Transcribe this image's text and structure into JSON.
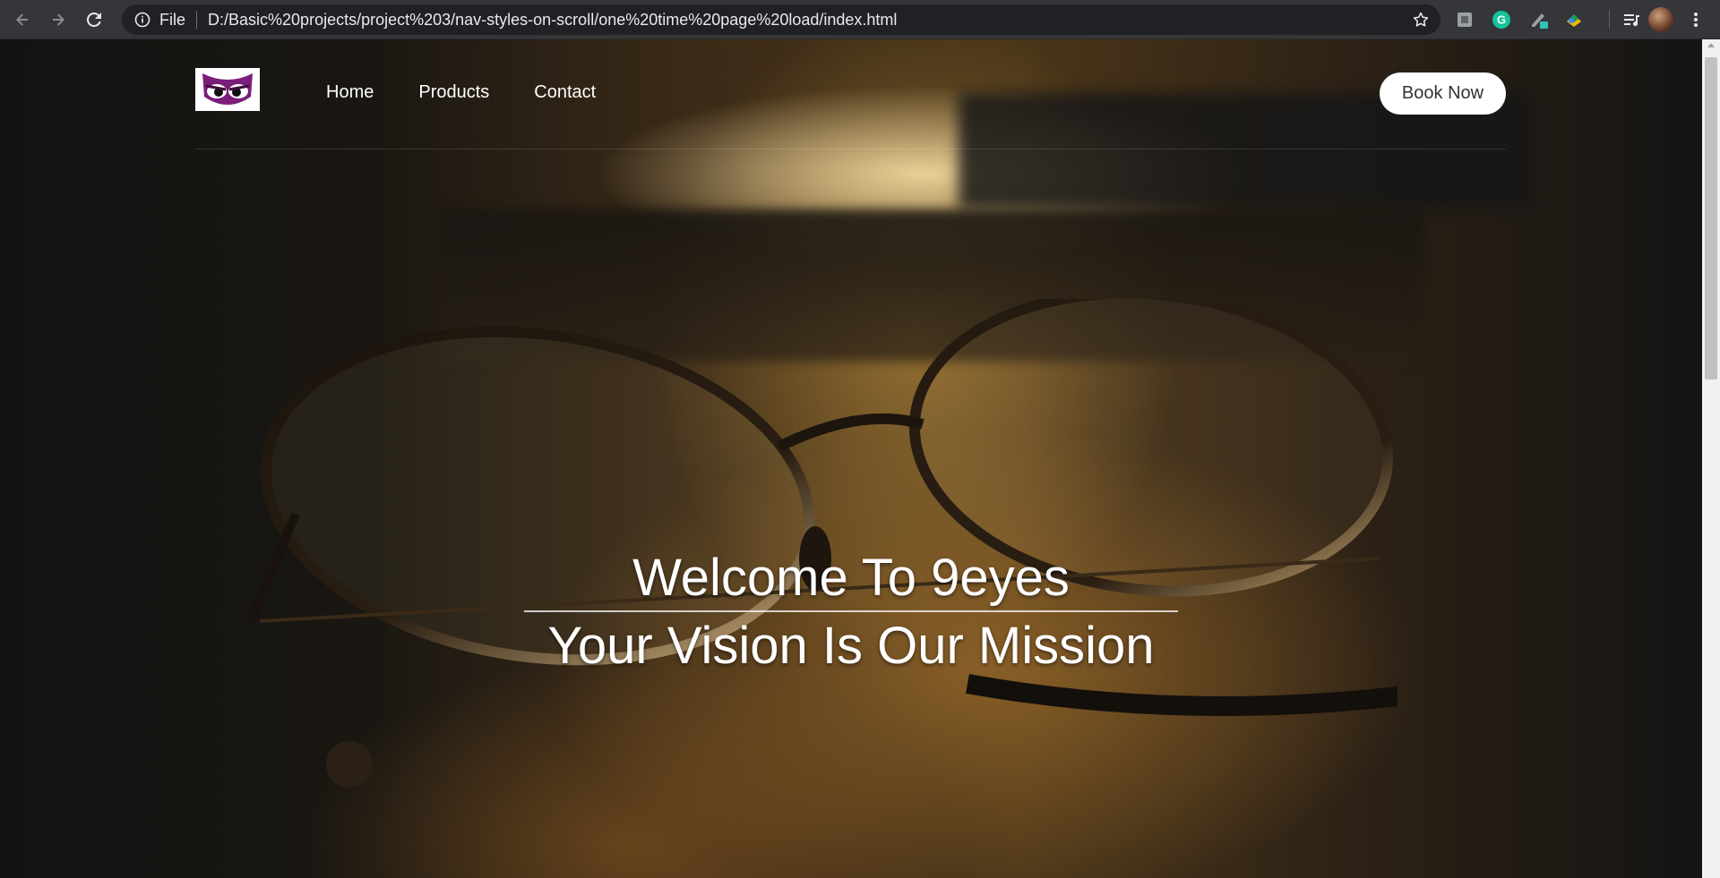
{
  "browser": {
    "scheme_label": "File",
    "url": "D:/Basic%20projects/project%203/nav-styles-on-scroll/one%20time%20page%20load/index.html"
  },
  "navbar": {
    "links": [
      {
        "label": "Home"
      },
      {
        "label": "Products"
      },
      {
        "label": "Contact"
      }
    ],
    "cta_label": "Book Now"
  },
  "hero": {
    "title": "Welcome To 9eyes",
    "subtitle": "Your Vision Is Our Mission"
  },
  "colors": {
    "logo_purple": "#7b1e7a",
    "chrome_bg": "#35363a",
    "omnibox_bg": "#202124"
  },
  "icons": [
    "back-icon",
    "forward-icon",
    "reload-icon",
    "info-icon",
    "star-icon",
    "extension-icon",
    "grammarly-icon",
    "reading-list-icon",
    "profile-avatar",
    "menu-icon",
    "owl-logo"
  ]
}
